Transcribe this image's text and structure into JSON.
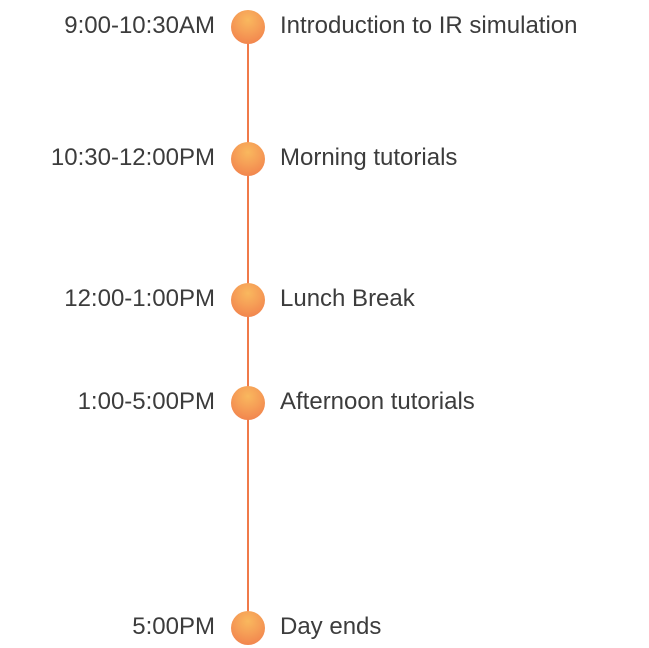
{
  "accent_color": "#f07a4a",
  "events": [
    {
      "time": "9:00-10:30AM",
      "title": "Introduction to IR simulation"
    },
    {
      "time": "10:30-12:00PM",
      "title": "Morning tutorials"
    },
    {
      "time": "12:00-1:00PM",
      "title": "Lunch Break"
    },
    {
      "time": "1:00-5:00PM",
      "title": "Afternoon tutorials"
    },
    {
      "time": "5:00PM",
      "title": "Day ends"
    }
  ]
}
